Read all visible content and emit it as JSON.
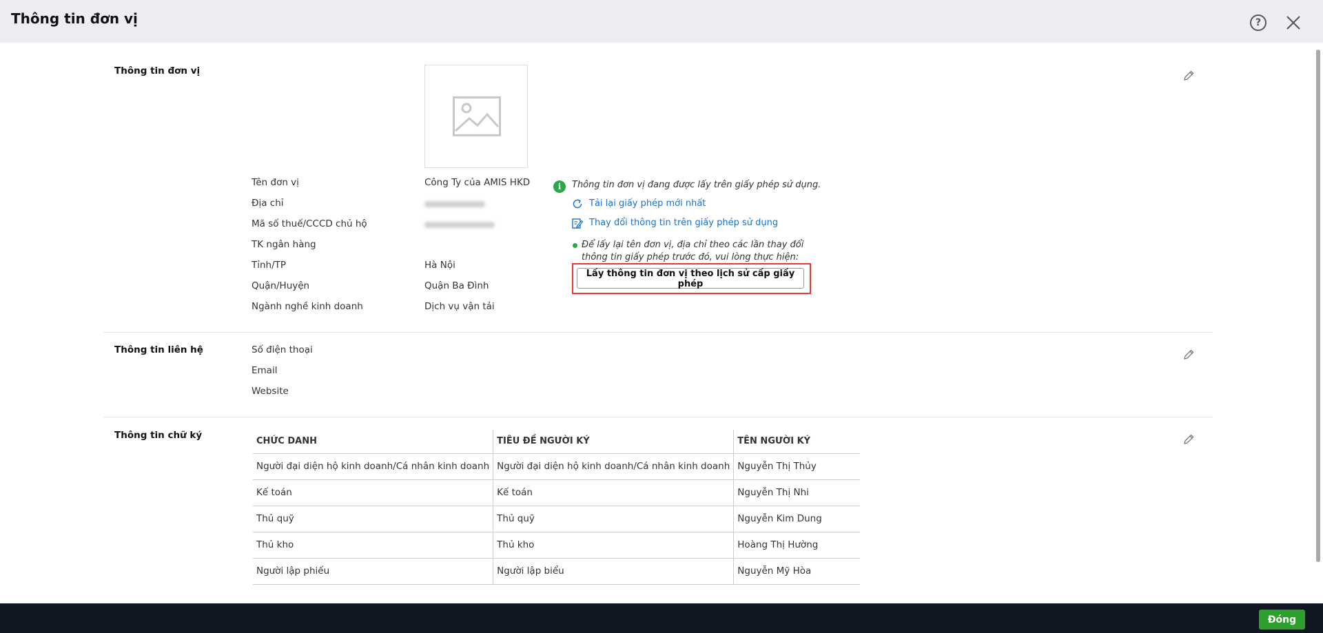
{
  "header": {
    "title": "Thông tin đơn vị"
  },
  "unit_info": {
    "section_title": "Thông tin đơn vị",
    "fields": [
      {
        "label": "Tên đơn vị",
        "value": "Công Ty của AMIS HKD"
      },
      {
        "label": "Địa chỉ",
        "value": ""
      },
      {
        "label": "Mã số thuế/CCCD chủ hộ",
        "value": ""
      },
      {
        "label": "TK ngân hàng",
        "value": ""
      },
      {
        "label": "Tỉnh/TP",
        "value": "Hà Nội"
      },
      {
        "label": "Quận/Huyện",
        "value": "Quận Ba Đình"
      },
      {
        "label": "Ngành nghề kinh doanh",
        "value": "Dịch vụ vận tải"
      }
    ],
    "license_info": "Thông tin đơn vị đang được lấy trên giấy phép sử dụng.",
    "reload_link": "Tải lại giấy phép mới nhất",
    "change_link": "Thay đổi thông tin trên giấy phép sử dụng",
    "note": "Để lấy lại tên đơn vị, địa chỉ theo các lần thay đổi thông tin giấy phép trước đó, vui lòng thực hiện:",
    "history_button": "Lấy thông tin đơn vị theo lịch sử cấp giấy phép"
  },
  "contact_info": {
    "section_title": "Thông tin liên hệ",
    "fields": [
      {
        "label": "Số điện thoại"
      },
      {
        "label": "Email"
      },
      {
        "label": "Website"
      }
    ]
  },
  "signature_info": {
    "section_title": "Thông tin chữ ký",
    "columns": [
      "CHỨC DANH",
      "TIÊU ĐỀ NGƯỜI KÝ",
      "TÊN NGƯỜI KÝ"
    ],
    "rows": [
      [
        "Người đại diện hộ kinh doanh/Cá nhân kinh doanh",
        "Người đại diện hộ kinh doanh/Cá nhân kinh doanh",
        "Nguyễn Thị Thủy"
      ],
      [
        "Kế toán",
        "Kế toán",
        "Nguyễn Thị Nhi"
      ],
      [
        "Thủ quỹ",
        "Thủ quỹ",
        "Nguyễn Kim Dung"
      ],
      [
        "Thủ kho",
        "Thủ kho",
        "Hoàng Thị Hường"
      ],
      [
        "Người lập phiếu",
        "Người lập biểu",
        "Nguyễn Mỹ Hòa"
      ]
    ]
  },
  "footer": {
    "close_button": "Đóng"
  }
}
